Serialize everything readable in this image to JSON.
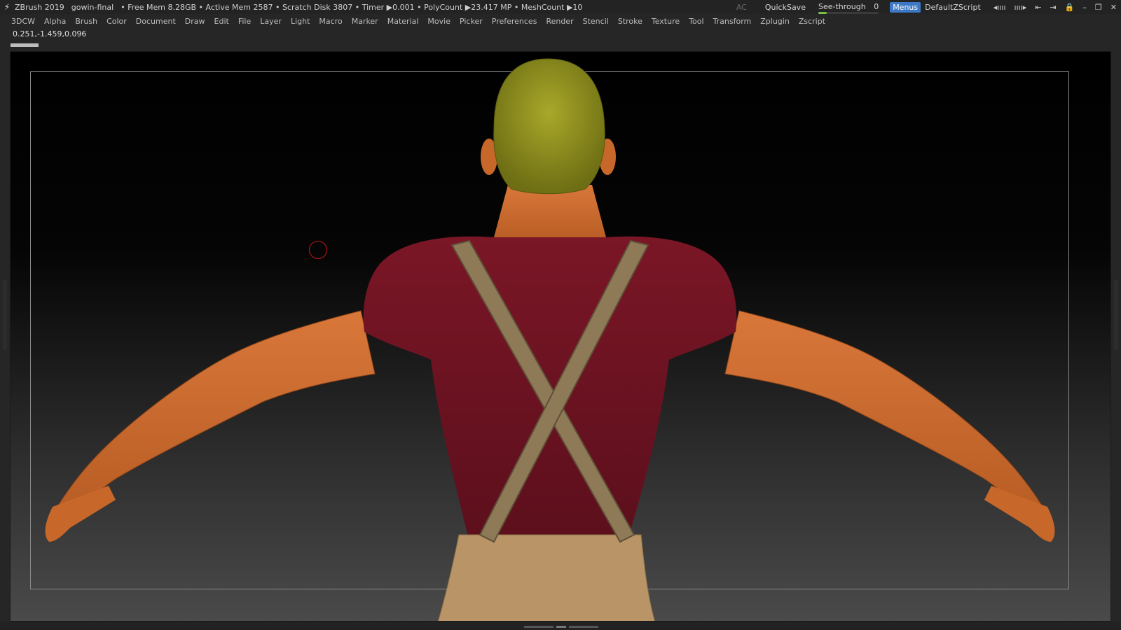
{
  "titlebar": {
    "app_name": "ZBrush 2019",
    "project": "gowin-final",
    "stats": "• Free Mem 8.28GB • Active Mem 2587 • Scratch Disk 3807 • Timer ▶0.001 • PolyCount ▶23.417 MP • MeshCount ▶10",
    "ac_label": "AC",
    "quicksave_label": "QuickSave",
    "seethrough_label": "See-through",
    "seethrough_value": "0",
    "menus_label": "Menus",
    "script_label": "DefaultZScript"
  },
  "menubar": {
    "items": [
      "3DCW",
      "Alpha",
      "Brush",
      "Color",
      "Document",
      "Draw",
      "Edit",
      "File",
      "Layer",
      "Light",
      "Macro",
      "Marker",
      "Material",
      "Movie",
      "Picker",
      "Preferences",
      "Render",
      "Stencil",
      "Stroke",
      "Texture",
      "Tool",
      "Transform",
      "Zplugin",
      "Zscript"
    ]
  },
  "coords": "0.251,-1.459,0.096",
  "colors": {
    "background": "#262626",
    "accent": "#3d78c6",
    "seethrough_fill": "#7ac143",
    "cursor": "#c21818",
    "skin": "#c8672a",
    "shirt": "#6b1220",
    "suspenders": "#8f7a58",
    "pants": "#b89466",
    "hair": "#9a9a1f"
  }
}
